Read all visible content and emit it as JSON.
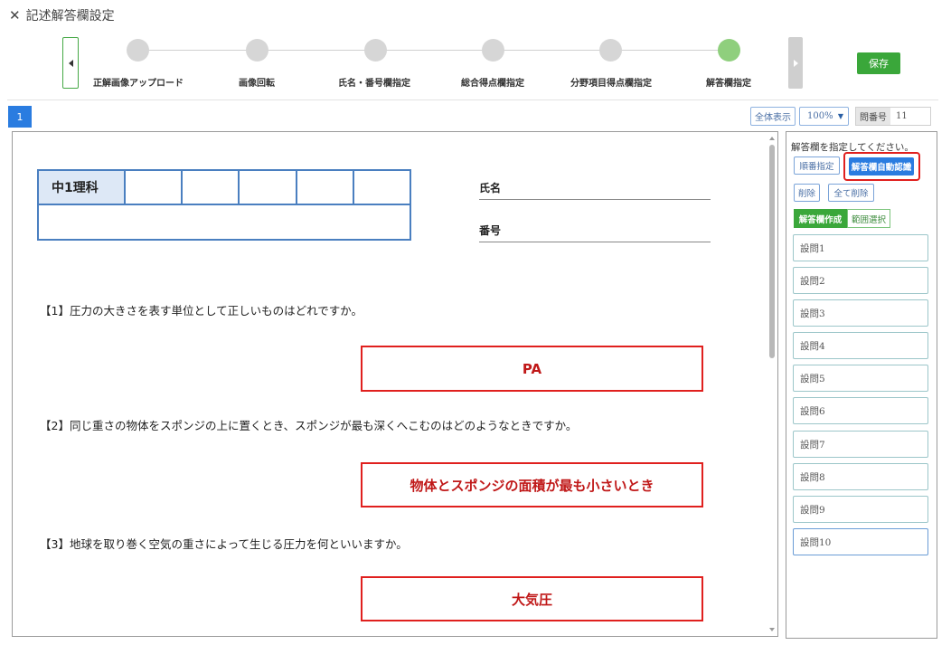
{
  "window": {
    "close_icon": "close-icon",
    "title": "記述解答欄設定"
  },
  "stepper": {
    "steps": [
      {
        "label": "正解画像アップロード",
        "active": false
      },
      {
        "label": "画像回転",
        "active": false
      },
      {
        "label": "氏名・番号欄指定",
        "active": false
      },
      {
        "label": "総合得点欄指定",
        "active": false
      },
      {
        "label": "分野項目得点欄指定",
        "active": false
      },
      {
        "label": "解答欄指定",
        "active": true
      }
    ],
    "save_label": "保存"
  },
  "toolbar": {
    "page_number": "1",
    "show_all_label": "全体表示",
    "zoom_value": "100%",
    "question_no_label": "問番号",
    "question_no_value": "11"
  },
  "document": {
    "subject": "中1理科",
    "name_label": "氏名",
    "number_label": "番号",
    "questions": [
      {
        "text": "【1】圧力の大きさを表す単位として正しいものはどれですか。",
        "answer": "PA"
      },
      {
        "text": "【2】同じ重さの物体をスポンジの上に置くとき、スポンジが最も深くへこむのはどのようなときですか。",
        "answer": "物体とスポンジの面積が最も小さいとき"
      },
      {
        "text": "【3】地球を取り巻く空気の重さによって生じる圧力を何といいますか。",
        "answer": "大気圧"
      }
    ]
  },
  "panel": {
    "hint": "解答欄を指定してください。",
    "order_label": "順番指定",
    "auto_detect_label": "解答欄自動認識",
    "delete_label": "削除",
    "delete_all_label": "全て削除",
    "mode_create_label": "解答欄作成",
    "mode_range_label": "範囲選択",
    "items": [
      "設問1",
      "設問2",
      "設問3",
      "設問4",
      "設問5",
      "設問6",
      "設問7",
      "設問8",
      "設問9",
      "設問10"
    ]
  },
  "colors": {
    "accent_blue": "#2a7ce0",
    "accent_green": "#3aa73a",
    "highlight_red": "#e0201e",
    "step_active": "#8fcf7d",
    "step_inactive": "#d6d6d6"
  }
}
